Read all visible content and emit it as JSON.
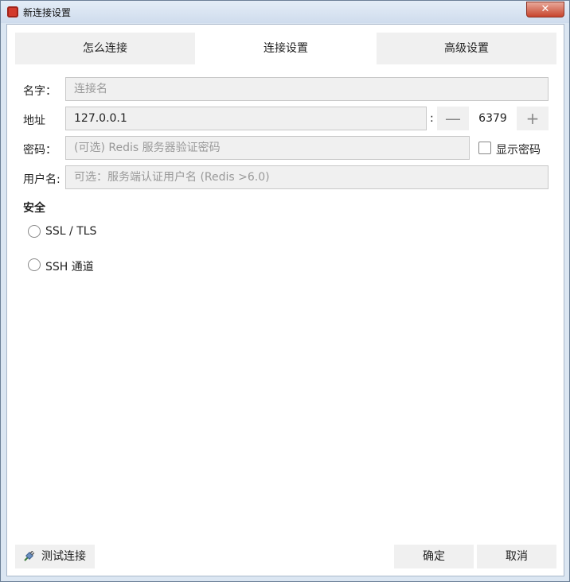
{
  "window": {
    "title": "新连接设置",
    "close_glyph": "✕"
  },
  "tabs": [
    {
      "label": "怎么连接"
    },
    {
      "label": "连接设置"
    },
    {
      "label": "高级设置"
    }
  ],
  "form": {
    "name_label": "名字：",
    "name_placeholder": "连接名",
    "address_label": "地址",
    "address_value": "127.0.0.1",
    "port_separator": ":",
    "port_value": "6379",
    "minus_glyph": "—",
    "plus_glyph": "+",
    "password_label": "密码：",
    "password_placeholder": "(可选) Redis 服务器验证密码",
    "show_password_label": "显示密码",
    "username_label": "用户名:",
    "username_placeholder": "可选：服务端认证用户名 (Redis >6.0)"
  },
  "security": {
    "title": "安全",
    "options": [
      {
        "label": "SSL / TLS"
      },
      {
        "label": "SSH 通道"
      }
    ]
  },
  "buttons": {
    "test": "测试连接",
    "ok": "确定",
    "cancel": "取消"
  },
  "icons": {
    "app": "redis-logo-icon",
    "test": "plug-icon"
  },
  "colors": {
    "tab_inactive": "#f0f0f0",
    "input_bg": "#f0f0f0",
    "close_red": "#c7442d"
  }
}
